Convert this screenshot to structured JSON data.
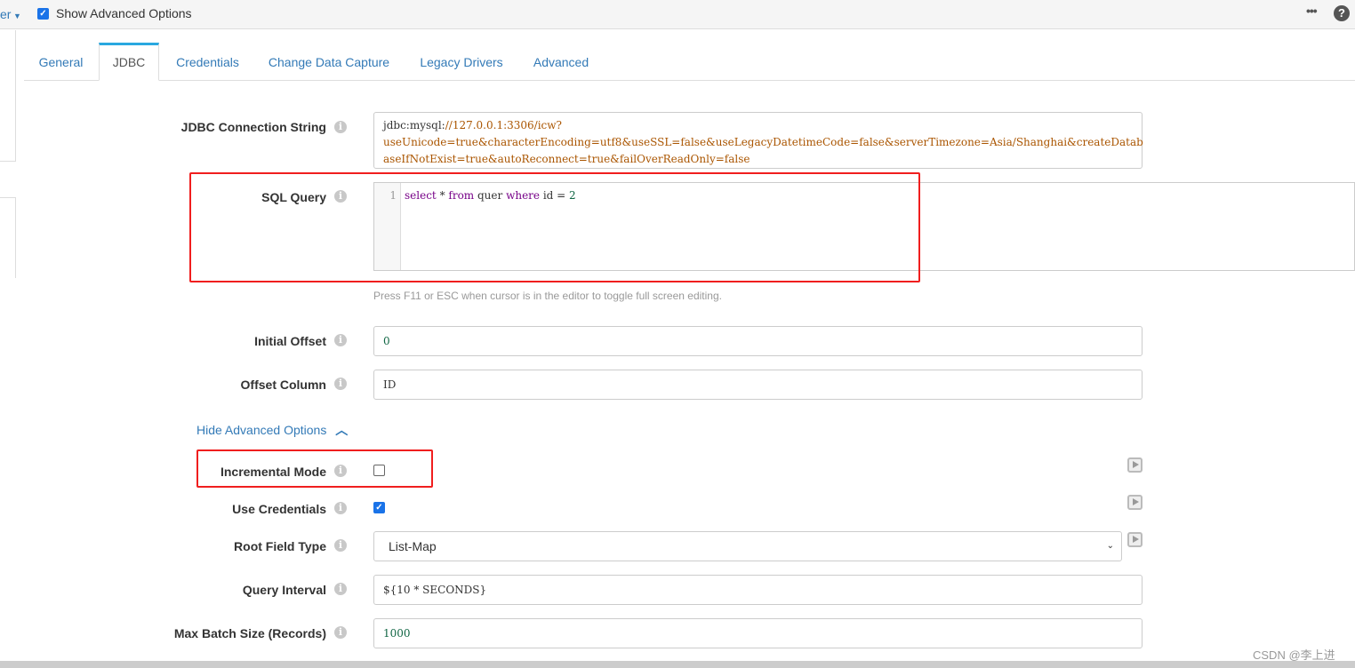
{
  "topbar": {
    "left_fragment": "er",
    "show_advanced_label": "Show Advanced Options",
    "show_advanced_checked": true,
    "more_icon": "ellipsis-icon",
    "help_icon": "question-circle-icon"
  },
  "tabs": [
    {
      "label": "General"
    },
    {
      "label": "JDBC",
      "active": true
    },
    {
      "label": "Credentials"
    },
    {
      "label": "Change Data Capture"
    },
    {
      "label": "Legacy Drivers"
    },
    {
      "label": "Advanced"
    }
  ],
  "form": {
    "jdbc": {
      "label": "JDBC Connection String",
      "prefix": "jdbc:mysql:",
      "rest_line1": "//127.0.0.1:3306/icw?",
      "line2": "useUnicode=true&characterEncoding=utf8&useSSL=false&useLegacyDatetimeCode=false&serverTimezone=Asia/Shanghai&createDatab",
      "line3": "aseIfNotExist=true&autoReconnect=true&failOverReadOnly=false"
    },
    "sql": {
      "label": "SQL Query",
      "line_number": "1",
      "kw_select": "select",
      "star": " * ",
      "kw_from": "from",
      "table": " quer ",
      "kw_where": "where",
      "cond": " id = ",
      "value": "2",
      "hint": "Press F11 or ESC when cursor is in the editor to toggle full screen editing."
    },
    "initial_offset": {
      "label": "Initial Offset",
      "value": "0"
    },
    "offset_column": {
      "label": "Offset Column",
      "value": "ID"
    },
    "hide_advanced": "Hide Advanced Options",
    "incremental_mode": {
      "label": "Incremental Mode",
      "checked": false
    },
    "use_credentials": {
      "label": "Use Credentials",
      "checked": true
    },
    "root_field_type": {
      "label": "Root Field Type",
      "value": "List-Map"
    },
    "query_interval": {
      "label": "Query Interval",
      "value": "${10 * SECONDS}"
    },
    "max_batch_size": {
      "label": "Max Batch Size (Records)",
      "value": "1000"
    }
  },
  "watermark": "CSDN @李上进",
  "colors": {
    "accent": "#337ab7",
    "active_tab": "#29a8e0",
    "highlight": "#f01e1e",
    "string": "#aa5500",
    "keyword": "#770088"
  }
}
